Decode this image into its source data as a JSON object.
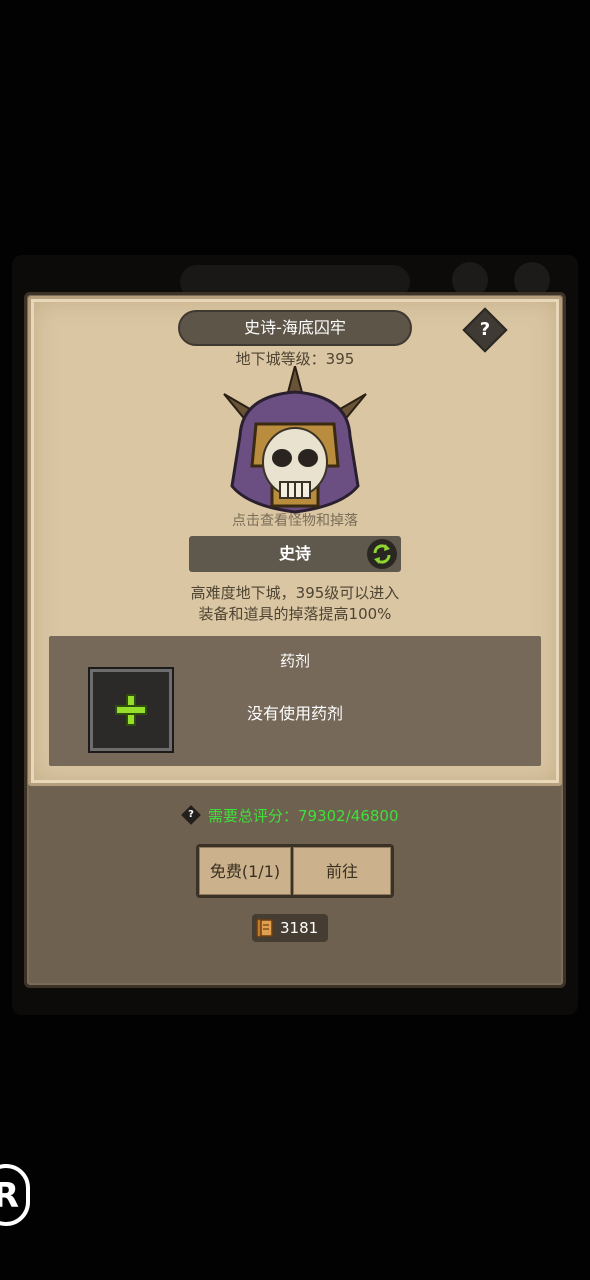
{
  "dungeon": {
    "title": "史诗-海底囚牢",
    "level_text": "地下城等级：395",
    "help_label": "?",
    "hint": "点击查看怪物和掉落"
  },
  "difficulty": {
    "label": "史诗",
    "desc_line1": "高难度地下城，395级可以进入",
    "desc_line2": "装备和道具的掉落提高100%"
  },
  "potion": {
    "title": "药剂",
    "status": "没有使用药剂"
  },
  "requirement": {
    "help_label": "?",
    "text": "需要总评分：79302/46800"
  },
  "buttons": {
    "free_label": "免费(1/1)",
    "go_label": "前往"
  },
  "currency": {
    "amount": "3181"
  },
  "colors": {
    "panel": "#6e6150",
    "paper": "#dac6a3",
    "requirement_green": "#3fe03a",
    "plus_green": "#96df2a"
  },
  "icons": [
    "help-diamond-icon",
    "monster-helmet-icon",
    "swap-arrows-icon",
    "plus-icon",
    "scroll-icon"
  ],
  "watermark": "R"
}
